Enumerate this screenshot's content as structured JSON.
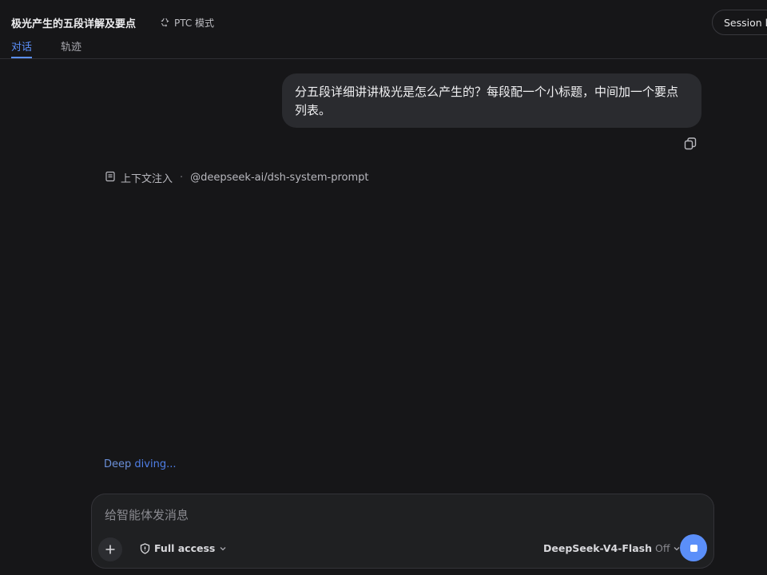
{
  "header": {
    "title": "极光产生的五段详解及要点",
    "mode_label": "PTC 模式",
    "session_button": "Session lo"
  },
  "tabs": [
    {
      "label": "对话",
      "active": true
    },
    {
      "label": "轨迹",
      "active": false
    }
  ],
  "conversation": {
    "user_message": "分五段详细讲讲极光是怎么产生的？每段配一个小标题，中间加一个要点列表。",
    "context_label": "上下文注入",
    "context_separator": "·",
    "context_source": "@deepseek-ai/dsh-system-prompt",
    "status_part1": "Deep",
    "status_part2": "diving..."
  },
  "composer": {
    "placeholder": "给智能体发消息",
    "value": "",
    "access_label": "Full access",
    "model_label": "DeepSeek-V4-Flash",
    "model_suffix": "Off"
  },
  "colors": {
    "accent": "#5b8ff9",
    "background": "#161618",
    "bubble": "#2a2b2f"
  }
}
